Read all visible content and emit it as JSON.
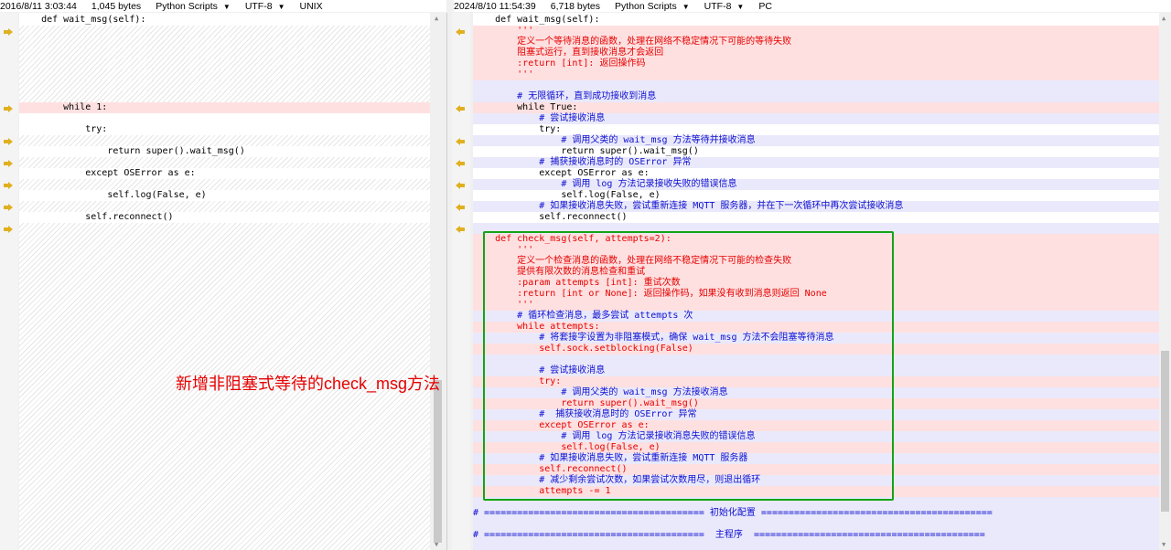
{
  "left_status": {
    "date": "2016/8/11 3:03:44",
    "size": "1,045 bytes",
    "language": "Python Scripts",
    "encoding": "UTF-8",
    "line_ending": "UNIX"
  },
  "right_status": {
    "date": "2024/8/10 11:54:39",
    "size": "6,718 bytes",
    "language": "Python Scripts",
    "encoding": "UTF-8",
    "line_ending": "PC"
  },
  "left_lines": [
    {
      "text": "    def wait_msg(self):",
      "bg": "plain",
      "color": "c-blk"
    },
    {
      "text": "",
      "bg": "hatch",
      "color": "c-blk"
    },
    {
      "text": "",
      "bg": "hatch",
      "color": "c-blk"
    },
    {
      "text": "",
      "bg": "hatch",
      "color": "c-blk"
    },
    {
      "text": "",
      "bg": "hatch",
      "color": "c-blk"
    },
    {
      "text": "",
      "bg": "hatch",
      "color": "c-blk"
    },
    {
      "text": "",
      "bg": "hatch",
      "color": "c-blk"
    },
    {
      "text": "",
      "bg": "hatch",
      "color": "c-blk"
    },
    {
      "text": "        while 1:",
      "bg": "pink",
      "color": "c-blk"
    },
    {
      "text": "",
      "bg": "plain",
      "color": "c-blk"
    },
    {
      "text": "            try:",
      "bg": "plain",
      "color": "c-blk"
    },
    {
      "text": "",
      "bg": "hatch",
      "color": "c-blk"
    },
    {
      "text": "                return super().wait_msg()",
      "bg": "plain",
      "color": "c-blk"
    },
    {
      "text": "",
      "bg": "hatch",
      "color": "c-blk"
    },
    {
      "text": "            except OSError as e:",
      "bg": "plain",
      "color": "c-blk"
    },
    {
      "text": "",
      "bg": "hatch",
      "color": "c-blk"
    },
    {
      "text": "                self.log(False, e)",
      "bg": "plain",
      "color": "c-blk"
    },
    {
      "text": "",
      "bg": "hatch",
      "color": "c-blk"
    },
    {
      "text": "            self.reconnect()",
      "bg": "plain",
      "color": "c-blk"
    }
  ],
  "right_lines": [
    {
      "text": "    def wait_msg(self):",
      "bg": "plain",
      "color": "c-blk"
    },
    {
      "text": "        '''",
      "bg": "pink",
      "color": "c-red"
    },
    {
      "text": "        定义一个等待消息的函数，处理在网络不稳定情况下可能的等待失败",
      "bg": "pink",
      "color": "c-red"
    },
    {
      "text": "        阻塞式运行，直到接收消息才会返回",
      "bg": "pink",
      "color": "c-red"
    },
    {
      "text": "        :return [int]: 返回操作码",
      "bg": "pink",
      "color": "c-red"
    },
    {
      "text": "        '''",
      "bg": "pink",
      "color": "c-red"
    },
    {
      "text": "",
      "bg": "lav",
      "color": "c-blk"
    },
    {
      "text": "        # 无限循环，直到成功接收到消息",
      "bg": "lav",
      "color": "c-blue"
    },
    {
      "text": "        while True:",
      "bg": "pink",
      "color": "c-blk"
    },
    {
      "text": "            # 尝试接收消息",
      "bg": "lav",
      "color": "c-blue"
    },
    {
      "text": "            try:",
      "bg": "plain",
      "color": "c-blk"
    },
    {
      "text": "                # 调用父类的 wait_msg 方法等待并接收消息",
      "bg": "lav",
      "color": "c-blue"
    },
    {
      "text": "                return super().wait_msg()",
      "bg": "plain",
      "color": "c-blk"
    },
    {
      "text": "            # 捕获接收消息时的 OSError 异常",
      "bg": "lav",
      "color": "c-blue"
    },
    {
      "text": "            except OSError as e:",
      "bg": "plain",
      "color": "c-blk"
    },
    {
      "text": "                # 调用 log 方法记录接收失败的错误信息",
      "bg": "lav",
      "color": "c-blue"
    },
    {
      "text": "                self.log(False, e)",
      "bg": "plain",
      "color": "c-blk"
    },
    {
      "text": "            # 如果接收消息失败，尝试重新连接 MQTT 服务器，并在下一次循环中再次尝试接收消息",
      "bg": "lav",
      "color": "c-blue"
    },
    {
      "text": "            self.reconnect()",
      "bg": "plain",
      "color": "c-blk"
    },
    {
      "text": "",
      "bg": "lav",
      "color": "c-blk"
    },
    {
      "text": "    def check_msg(self, attempts=2):",
      "bg": "pink",
      "color": "c-red"
    },
    {
      "text": "        '''",
      "bg": "pink",
      "color": "c-red"
    },
    {
      "text": "        定义一个检查消息的函数，处理在网络不稳定情况下可能的检查失败",
      "bg": "pink",
      "color": "c-red"
    },
    {
      "text": "        提供有限次数的消息检查和重试",
      "bg": "pink",
      "color": "c-red"
    },
    {
      "text": "        :param attempts [int]: 重试次数",
      "bg": "pink",
      "color": "c-red"
    },
    {
      "text": "        :return [int or None]: 返回操作码，如果没有收到消息则返回 None",
      "bg": "pink",
      "color": "c-red"
    },
    {
      "text": "        '''",
      "bg": "pink",
      "color": "c-red"
    },
    {
      "text": "        # 循环检查消息，最多尝试 attempts 次",
      "bg": "lav",
      "color": "c-blue"
    },
    {
      "text": "        while attempts:",
      "bg": "pink",
      "color": "c-red"
    },
    {
      "text": "            # 将套接字设置为非阻塞模式，确保 wait_msg 方法不会阻塞等待消息",
      "bg": "lav",
      "color": "c-blue"
    },
    {
      "text": "            self.sock.setblocking(False)",
      "bg": "pink",
      "color": "c-red"
    },
    {
      "text": "",
      "bg": "lav",
      "color": "c-blk"
    },
    {
      "text": "            # 尝试接收消息",
      "bg": "lav",
      "color": "c-blue"
    },
    {
      "text": "            try:",
      "bg": "pink",
      "color": "c-red"
    },
    {
      "text": "                # 调用父类的 wait_msg 方法接收消息",
      "bg": "lav",
      "color": "c-blue"
    },
    {
      "text": "                return super().wait_msg()",
      "bg": "pink",
      "color": "c-red"
    },
    {
      "text": "            #  捕获接收消息时的 OSError 异常",
      "bg": "lav",
      "color": "c-blue"
    },
    {
      "text": "            except OSError as e:",
      "bg": "pink",
      "color": "c-red"
    },
    {
      "text": "                # 调用 log 方法记录接收消息失败的错误信息",
      "bg": "lav",
      "color": "c-blue"
    },
    {
      "text": "                self.log(False, e)",
      "bg": "pink",
      "color": "c-red"
    },
    {
      "text": "            # 如果接收消息失败，尝试重新连接 MQTT 服务器",
      "bg": "lav",
      "color": "c-blue"
    },
    {
      "text": "            self.reconnect()",
      "bg": "pink",
      "color": "c-red"
    },
    {
      "text": "            # 减少剩余尝试次数，如果尝试次数用尽，则退出循环",
      "bg": "lav",
      "color": "c-blue"
    },
    {
      "text": "            attempts -= 1",
      "bg": "pink",
      "color": "c-red"
    },
    {
      "text": "",
      "bg": "lav",
      "color": "c-blk"
    },
    {
      "text": "# ======================================== 初始化配置 ==========================================",
      "bg": "lav",
      "color": "c-blue"
    },
    {
      "text": "",
      "bg": "lav",
      "color": "c-blk"
    },
    {
      "text": "# ========================================  主程序  ==========================================",
      "bg": "lav",
      "color": "c-blue"
    },
    {
      "text": "",
      "bg": "lav",
      "color": "c-blk"
    }
  ],
  "annotation": "新增非阻塞式等待的check_msg方法",
  "colors": {
    "added": "#ffe0e0",
    "changed": "#e9e9fb",
    "box": "#16a316",
    "annotation": "#e60000",
    "arrow": "#d4a017"
  }
}
